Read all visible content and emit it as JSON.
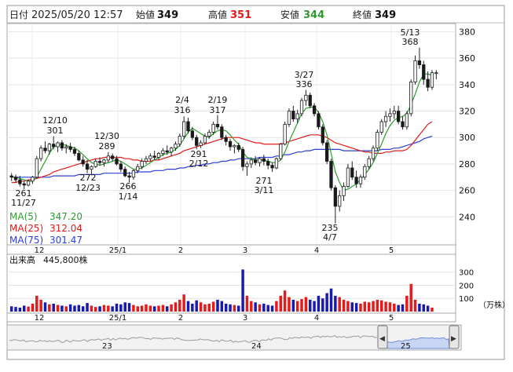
{
  "header": {
    "date_label": "日付",
    "date_value": "2025/05/20 12:57",
    "open_label": "始値",
    "open_value": "349",
    "high_label": "高値",
    "high_value": "351",
    "low_label": "安値",
    "low_value": "344",
    "close_label": "終値",
    "close_value": "349"
  },
  "colors": {
    "up": "#e31b1b",
    "down": "#1a1ab0",
    "ma5": "#2e9a2e",
    "ma25": "#e31b1b",
    "ma75": "#2f3fd4",
    "high_value": "#e31b1b",
    "low_value": "#2e9a2e"
  },
  "legend": [
    {
      "label": "MA(5)",
      "value": "347.20",
      "color": "#2e9a2e"
    },
    {
      "label": "MA(25)",
      "value": "312.04",
      "color": "#e31b1b"
    },
    {
      "label": "MA(75)",
      "value": "301.47",
      "color": "#2f3fd4"
    }
  ],
  "volume_panel": {
    "label": "出来高",
    "value": "445,800株",
    "unit": "（万株）",
    "ticks": [
      "300",
      "200",
      "100"
    ]
  },
  "navigator": {
    "labels": [
      "23",
      "24",
      "25"
    ],
    "left_button": "◀",
    "right_button": "▶"
  },
  "chart_data": {
    "type": "candlestick",
    "y_ticks": [
      "380",
      "360",
      "340",
      "320",
      "300",
      "280",
      "260",
      "240"
    ],
    "ylim": [
      220,
      385
    ],
    "x_labels": [
      "12",
      "25/1",
      "2",
      "3",
      "4",
      "5"
    ],
    "annotations": [
      {
        "date": "12/10",
        "value": "301"
      },
      {
        "date": "12/30",
        "value": "289"
      },
      {
        "date": "2/4",
        "value": "316"
      },
      {
        "date": "2/19",
        "value": "317"
      },
      {
        "date": "3/27",
        "value": "336"
      },
      {
        "date": "5/13",
        "value": "368"
      },
      {
        "date": "11/27",
        "value": "261"
      },
      {
        "date": "12/23",
        "value": "272"
      },
      {
        "date": "1/14",
        "value": "266"
      },
      {
        "date": "2/12",
        "value": "291"
      },
      {
        "date": "3/11",
        "value": "271"
      },
      {
        "date": "4/7",
        "value": "235"
      }
    ],
    "candles": [
      [
        271,
        273,
        267,
        270
      ],
      [
        270,
        272,
        266,
        268
      ],
      [
        268,
        271,
        263,
        265
      ],
      [
        265,
        267,
        261,
        264
      ],
      [
        264,
        268,
        263,
        267
      ],
      [
        267,
        271,
        265,
        270
      ],
      [
        270,
        286,
        269,
        284
      ],
      [
        284,
        294,
        282,
        292
      ],
      [
        292,
        297,
        288,
        290
      ],
      [
        290,
        296,
        287,
        295
      ],
      [
        295,
        301,
        291,
        293
      ],
      [
        293,
        297,
        289,
        296
      ],
      [
        296,
        298,
        290,
        292
      ],
      [
        292,
        295,
        288,
        293
      ],
      [
        293,
        296,
        289,
        291
      ],
      [
        291,
        293,
        286,
        288
      ],
      [
        288,
        290,
        282,
        283
      ],
      [
        283,
        286,
        278,
        280
      ],
      [
        280,
        283,
        273,
        276
      ],
      [
        276,
        279,
        272,
        278
      ],
      [
        278,
        284,
        277,
        282
      ],
      [
        282,
        285,
        279,
        281
      ],
      [
        281,
        284,
        278,
        283
      ],
      [
        283,
        289,
        281,
        286
      ],
      [
        286,
        288,
        282,
        284
      ],
      [
        284,
        286,
        279,
        280
      ],
      [
        280,
        282,
        274,
        276
      ],
      [
        276,
        278,
        270,
        271
      ],
      [
        271,
        274,
        266,
        270
      ],
      [
        270,
        276,
        268,
        275
      ],
      [
        275,
        280,
        273,
        278
      ],
      [
        278,
        284,
        276,
        282
      ],
      [
        282,
        286,
        280,
        284
      ],
      [
        284,
        288,
        282,
        286
      ],
      [
        286,
        290,
        283,
        285
      ],
      [
        285,
        289,
        283,
        288
      ],
      [
        288,
        292,
        286,
        290
      ],
      [
        290,
        294,
        287,
        289
      ],
      [
        289,
        293,
        286,
        292
      ],
      [
        292,
        297,
        290,
        295
      ],
      [
        295,
        303,
        293,
        301
      ],
      [
        301,
        316,
        299,
        312
      ],
      [
        312,
        315,
        303,
        305
      ],
      [
        305,
        308,
        298,
        300
      ],
      [
        300,
        302,
        291,
        294
      ],
      [
        294,
        298,
        292,
        296
      ],
      [
        296,
        303,
        295,
        301
      ],
      [
        301,
        306,
        299,
        304
      ],
      [
        304,
        312,
        302,
        310
      ],
      [
        310,
        317,
        306,
        308
      ],
      [
        308,
        310,
        298,
        300
      ],
      [
        300,
        302,
        294,
        297
      ],
      [
        297,
        299,
        290,
        293
      ],
      [
        293,
        295,
        288,
        294
      ],
      [
        294,
        296,
        289,
        291
      ],
      [
        291,
        293,
        275,
        278
      ],
      [
        278,
        282,
        271,
        280
      ],
      [
        280,
        285,
        277,
        283
      ],
      [
        283,
        286,
        279,
        281
      ],
      [
        281,
        285,
        278,
        284
      ],
      [
        284,
        287,
        279,
        282
      ],
      [
        282,
        284,
        276,
        279
      ],
      [
        279,
        281,
        274,
        277
      ],
      [
        277,
        285,
        276,
        284
      ],
      [
        284,
        296,
        283,
        295
      ],
      [
        295,
        312,
        294,
        310
      ],
      [
        310,
        322,
        308,
        320
      ],
      [
        320,
        324,
        312,
        314
      ],
      [
        314,
        321,
        311,
        318
      ],
      [
        318,
        330,
        316,
        328
      ],
      [
        328,
        336,
        324,
        332
      ],
      [
        332,
        334,
        322,
        324
      ],
      [
        324,
        326,
        316,
        318
      ],
      [
        318,
        320,
        306,
        308
      ],
      [
        308,
        310,
        294,
        296
      ],
      [
        296,
        298,
        280,
        282
      ],
      [
        282,
        284,
        260,
        262
      ],
      [
        262,
        264,
        235,
        248
      ],
      [
        248,
        260,
        244,
        256
      ],
      [
        256,
        266,
        252,
        263
      ],
      [
        263,
        280,
        262,
        277
      ],
      [
        277,
        282,
        268,
        270
      ],
      [
        270,
        275,
        262,
        265
      ],
      [
        265,
        272,
        262,
        270
      ],
      [
        270,
        280,
        268,
        278
      ],
      [
        278,
        286,
        276,
        284
      ],
      [
        284,
        294,
        282,
        292
      ],
      [
        292,
        306,
        290,
        304
      ],
      [
        304,
        314,
        302,
        312
      ],
      [
        312,
        320,
        308,
        316
      ],
      [
        316,
        322,
        312,
        318
      ],
      [
        318,
        324,
        314,
        320
      ],
      [
        320,
        324,
        310,
        312
      ],
      [
        312,
        316,
        306,
        308
      ],
      [
        308,
        320,
        306,
        318
      ],
      [
        318,
        344,
        316,
        342
      ],
      [
        342,
        362,
        340,
        358
      ],
      [
        358,
        368,
        352,
        355
      ],
      [
        355,
        358,
        340,
        344
      ],
      [
        344,
        350,
        335,
        338
      ],
      [
        338,
        351,
        336,
        349
      ],
      [
        349,
        351,
        344,
        349
      ]
    ],
    "volumes": [
      40,
      35,
      30,
      45,
      38,
      60,
      120,
      90,
      70,
      55,
      60,
      50,
      45,
      40,
      55,
      45,
      50,
      40,
      65,
      45,
      35,
      40,
      50,
      45,
      40,
      60,
      55,
      70,
      65,
      50,
      40,
      45,
      55,
      45,
      40,
      45,
      50,
      40,
      55,
      70,
      90,
      130,
      80,
      60,
      85,
      70,
      55,
      60,
      75,
      90,
      80,
      60,
      55,
      50,
      45,
      320,
      120,
      80,
      70,
      55,
      60,
      50,
      45,
      80,
      120,
      160,
      110,
      90,
      80,
      95,
      110,
      90,
      80,
      120,
      100,
      140,
      175,
      120,
      110,
      90,
      80,
      70,
      65,
      60,
      75,
      70,
      80,
      90,
      85,
      75,
      70,
      60,
      50,
      55,
      120,
      210,
      90,
      60,
      55,
      45,
      30
    ],
    "ma5": [
      270,
      270,
      269,
      268,
      267,
      267,
      270,
      276,
      282,
      288,
      293,
      294,
      295,
      294,
      293,
      292,
      290,
      287,
      284,
      281,
      280,
      279,
      280,
      281,
      282,
      283,
      282,
      280,
      278,
      276,
      276,
      277,
      279,
      281,
      283,
      285,
      287,
      288,
      289,
      291,
      294,
      299,
      304,
      307,
      305,
      303,
      301,
      300,
      303,
      305,
      306,
      305,
      302,
      298,
      295,
      289,
      285,
      284,
      283,
      283,
      283,
      282,
      281,
      281,
      283,
      289,
      297,
      304,
      311,
      318,
      322,
      323,
      323,
      319,
      312,
      302,
      288,
      274,
      266,
      260,
      261,
      263,
      265,
      268,
      272,
      276,
      281,
      288,
      295,
      303,
      309,
      313,
      315,
      316,
      318,
      325,
      333,
      342,
      348,
      348,
      347
    ],
    "ma25": [
      266,
      266,
      267,
      267,
      268,
      268,
      269,
      270,
      271,
      272,
      274,
      275,
      276,
      277,
      278,
      279,
      280,
      281,
      282,
      283,
      284,
      284,
      285,
      285,
      285,
      285,
      285,
      284,
      284,
      283,
      283,
      282,
      282,
      282,
      283,
      283,
      284,
      285,
      286,
      287,
      288,
      290,
      291,
      292,
      293,
      294,
      295,
      296,
      297,
      298,
      299,
      300,
      300,
      300,
      300,
      299,
      298,
      297,
      296,
      296,
      295,
      295,
      295,
      295,
      295,
      296,
      297,
      298,
      299,
      300,
      301,
      302,
      302,
      302,
      301,
      300,
      298,
      296,
      295,
      294,
      293,
      292,
      291,
      290,
      289,
      289,
      288,
      288,
      288,
      289,
      289,
      290,
      290,
      290,
      291,
      294,
      298,
      302,
      306,
      310,
      312
    ],
    "ma75": [
      270,
      270,
      270,
      270,
      270,
      270,
      270,
      270,
      270,
      270,
      271,
      271,
      271,
      271,
      271,
      271,
      272,
      272,
      272,
      272,
      272,
      272,
      273,
      273,
      273,
      273,
      273,
      273,
      273,
      273,
      274,
      274,
      274,
      274,
      275,
      275,
      275,
      276,
      276,
      276,
      277,
      277,
      278,
      278,
      279,
      279,
      280,
      280,
      281,
      281,
      282,
      282,
      283,
      283,
      284,
      284,
      284,
      284,
      284,
      285,
      285,
      285,
      285,
      286,
      286,
      287,
      287,
      288,
      289,
      289,
      290,
      290,
      291,
      291,
      291,
      291,
      291,
      291,
      291,
      290,
      290,
      290,
      290,
      290,
      290,
      290,
      290,
      290,
      291,
      291,
      291,
      292,
      292,
      293,
      294,
      295,
      296,
      297,
      299,
      300,
      301
    ]
  }
}
